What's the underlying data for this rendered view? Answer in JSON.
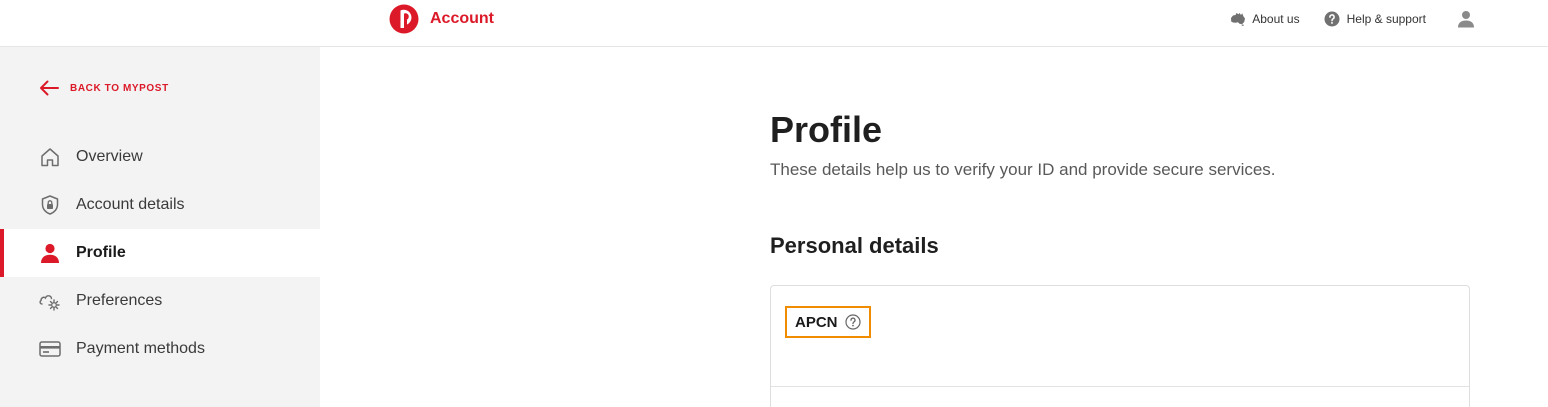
{
  "header": {
    "brand_label": "Account",
    "about_label": "About us",
    "help_label": "Help & support",
    "brand_color": "#dc1928"
  },
  "sidebar": {
    "back_label": "BACK TO MYPOST",
    "items": [
      {
        "label": "Overview",
        "icon": "home-icon",
        "active": false
      },
      {
        "label": "Account details",
        "icon": "shield-lock-icon",
        "active": false
      },
      {
        "label": "Profile",
        "icon": "person-icon",
        "active": true
      },
      {
        "label": "Preferences",
        "icon": "gear-cloud-icon",
        "active": false
      },
      {
        "label": "Payment methods",
        "icon": "credit-card-icon",
        "active": false
      }
    ]
  },
  "main": {
    "title": "Profile",
    "subtitle": "These details help us to verify your ID and provide secure services.",
    "section_title": "Personal details",
    "card": {
      "field_label": "APCN",
      "highlight_color": "#f08c00"
    }
  }
}
